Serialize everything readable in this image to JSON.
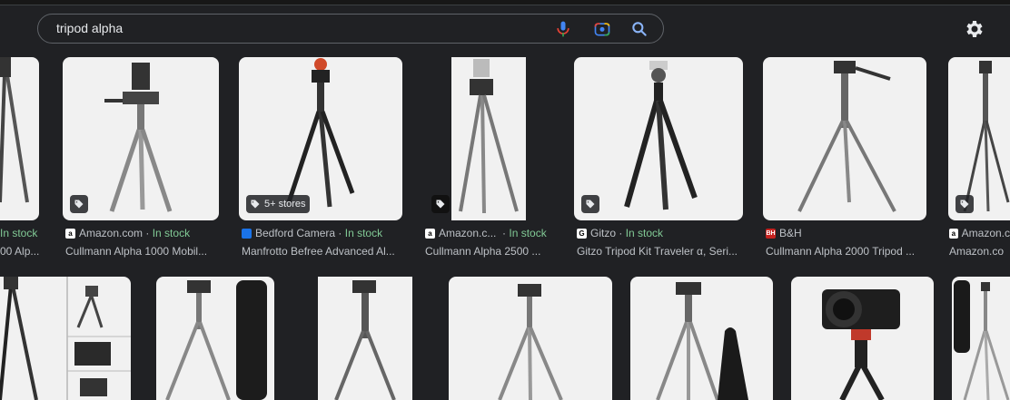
{
  "search": {
    "query": "tripod alpha"
  },
  "icons": {
    "mic": "mic-icon",
    "lens": "lens-icon",
    "search": "search-icon",
    "settings": "gear-icon",
    "tag": "tag-icon"
  },
  "row1": [
    {
      "source": "",
      "stock": "In stock",
      "title": "00 Alp..."
    },
    {
      "source": "Amazon.com",
      "stock": "In stock",
      "title": "Cullmann Alpha 1000 Mobil..."
    },
    {
      "source": "Bedford Camera",
      "stock": "In stock",
      "title": "Manfrotto Befree Advanced Al...",
      "badge": "5+ stores"
    },
    {
      "source": "Amazon.c...",
      "stock": "In stock",
      "title": "Cullmann Alpha 2500 ..."
    },
    {
      "source": "Gitzo",
      "stock": "In stock",
      "title": "Gitzo Tripod Kit Traveler α, Seri..."
    },
    {
      "source": "B&H",
      "stock": "",
      "title": "Cullmann Alpha 2000 Tripod ..."
    },
    {
      "source": "Amazon.c",
      "stock": "",
      "title": "Amazon.co"
    }
  ],
  "separator": "·"
}
